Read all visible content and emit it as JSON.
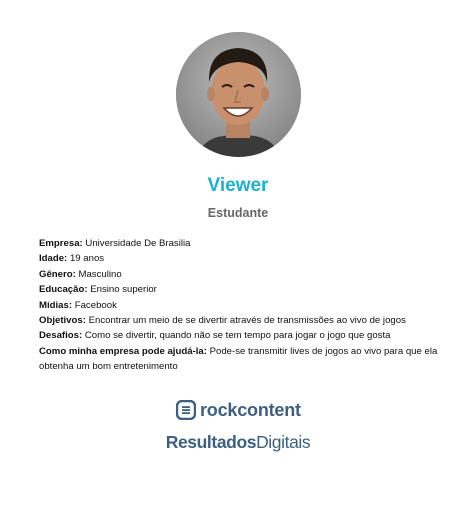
{
  "persona": {
    "name": "Viewer",
    "role": "Estudante"
  },
  "details": [
    {
      "label": "Empresa:",
      "value": "Universidade De Brasilia"
    },
    {
      "label": "Idade:",
      "value": "19 anos"
    },
    {
      "label": "Gênero:",
      "value": "Masculino"
    },
    {
      "label": "Educação:",
      "value": "Ensino superior"
    },
    {
      "label": "Mídias:",
      "value": "Facebook"
    },
    {
      "label": "Objetivos:",
      "value": "Encontrar um meio de se divertir através de transmissões ao vivo de jogos"
    },
    {
      "label": "Desafios:",
      "value": "Como se divertir, quando não se tem tempo para jogar o jogo que gosta"
    },
    {
      "label": "Como minha empresa pode ajudá-la:",
      "value": "Pode-se transmitir lives de jogos ao vivo para que ela obtenha um bom entretenimento"
    }
  ],
  "logos": {
    "rockcontent": "rockcontent",
    "resultados_bold": "Resultados",
    "resultados_regular": "Digitais"
  },
  "colors": {
    "accent": "#1ab2cf",
    "subtitle": "#666666",
    "logo": "#3d5f82"
  }
}
